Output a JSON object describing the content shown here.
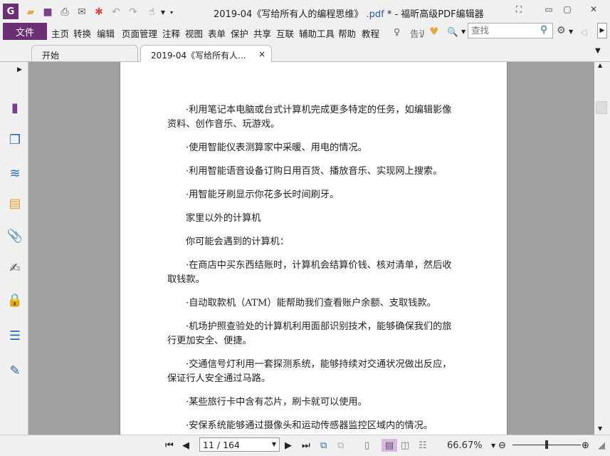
{
  "window": {
    "title_main": "2019-04《写给所有人的编程思维》",
    "title_ext": ".pdf",
    "title_suffix": " * - 福昕高级PDF编辑器"
  },
  "menu": {
    "file": "文件",
    "items": [
      "主页",
      "转换",
      "编辑",
      "页面管理",
      "注释",
      "视图",
      "表单",
      "保护",
      "共享",
      "互联",
      "辅助工具",
      "帮助",
      "教程"
    ],
    "tell_me": "告诉"
  },
  "search": {
    "placeholder": "查找"
  },
  "tabs": [
    {
      "label": "开始"
    },
    {
      "label": "2019-04《写给所有人...",
      "close": "×"
    }
  ],
  "document": {
    "paragraphs": [
      "·利用笔记本电脑或台式计算机完成更多特定的任务，如编辑影像资料、创作音乐、玩游戏。",
      "·使用智能仪表测算家中采暖、用电的情况。",
      "·利用智能语音设备订购日用百货、播放音乐、实现网上搜索。",
      "·用智能牙刷显示你花多长时间刷牙。",
      "家里以外的计算机",
      "你可能会遇到的计算机：",
      "·在商店中买东西结账时，计算机会结算价钱、核对清单，然后收取钱款。",
      "·自动取款机（ATM）能帮助我们查看账户余额、支取钱款。",
      "·机场护照查验处的计算机利用面部识别技术，能够确保我们的旅行更加安全、便捷。",
      "·交通信号灯利用一套探测系统，能够持续对交通状况做出反应，保证行人安全通过马路。",
      "·某些旅行卡中含有芯片，刷卡就可以使用。",
      "·安保系统能够通过摄像头和运动传感器监控区域内的情况。"
    ]
  },
  "status": {
    "page": "11 / 164",
    "zoom": "66.67%",
    "zoom_fraction": 0.5
  },
  "colors": {
    "accent": "#6b2f73",
    "viewer_bg": "#a0a0a0"
  }
}
